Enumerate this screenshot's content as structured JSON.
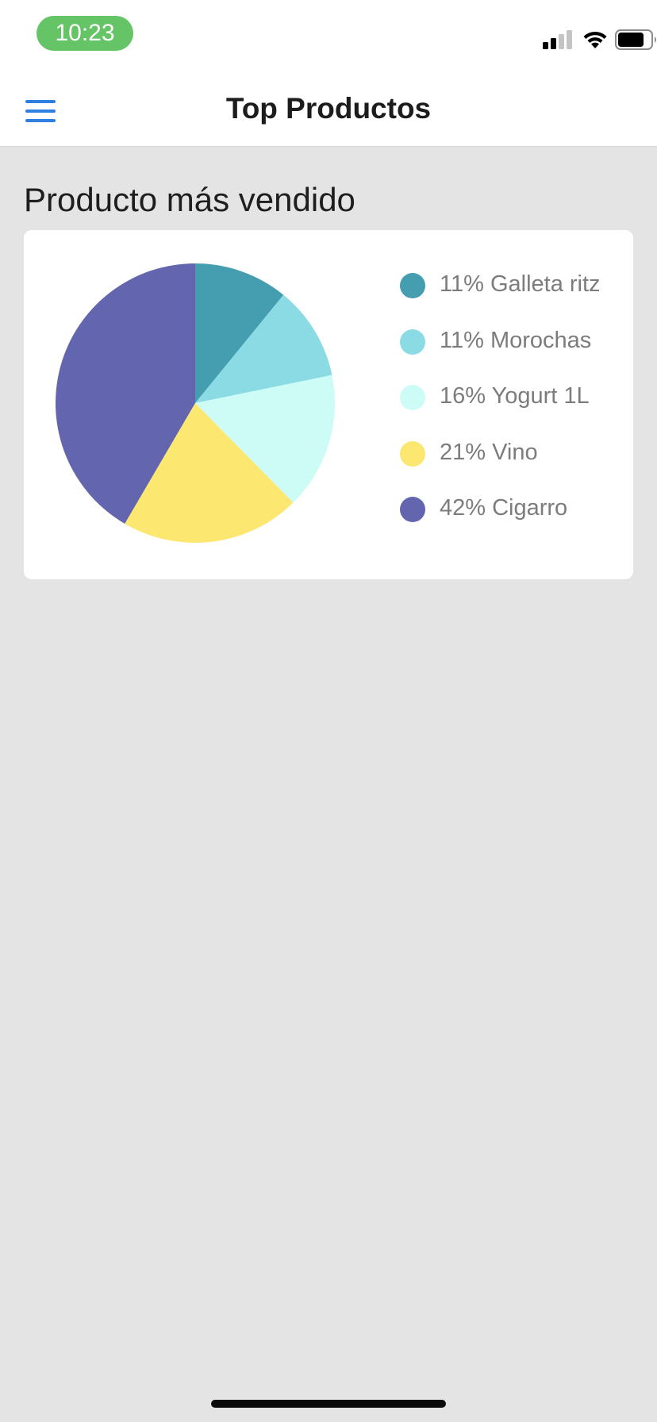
{
  "status_bar": {
    "time": "10:23",
    "time_pill_color": "#65c466",
    "icons": [
      "cellular-signal-icon",
      "wifi-icon",
      "battery-icon"
    ]
  },
  "nav": {
    "title": "Top Productos",
    "menu_icon": "hamburger-menu-icon",
    "accent_color": "#2f7fe1"
  },
  "section": {
    "title": "Producto más vendido"
  },
  "chart_data": {
    "type": "pie",
    "slices": [
      {
        "label": "Galleta ritz",
        "percent": 11,
        "display": "11% Galleta ritz",
        "color": "#459db0"
      },
      {
        "label": "Morochas",
        "percent": 11,
        "display": "11% Morochas",
        "color": "#8bdbe5"
      },
      {
        "label": "Yogurt 1L",
        "percent": 16,
        "display": "16% Yogurt 1L",
        "color": "#cdfcf7"
      },
      {
        "label": "Vino",
        "percent": 21,
        "display": "21% Vino",
        "color": "#fce770"
      },
      {
        "label": "Cigarro",
        "percent": 42,
        "display": "42% Cigarro",
        "color": "#6366ae"
      }
    ],
    "legend_position": "right",
    "start_angle": "top, clockwise"
  }
}
